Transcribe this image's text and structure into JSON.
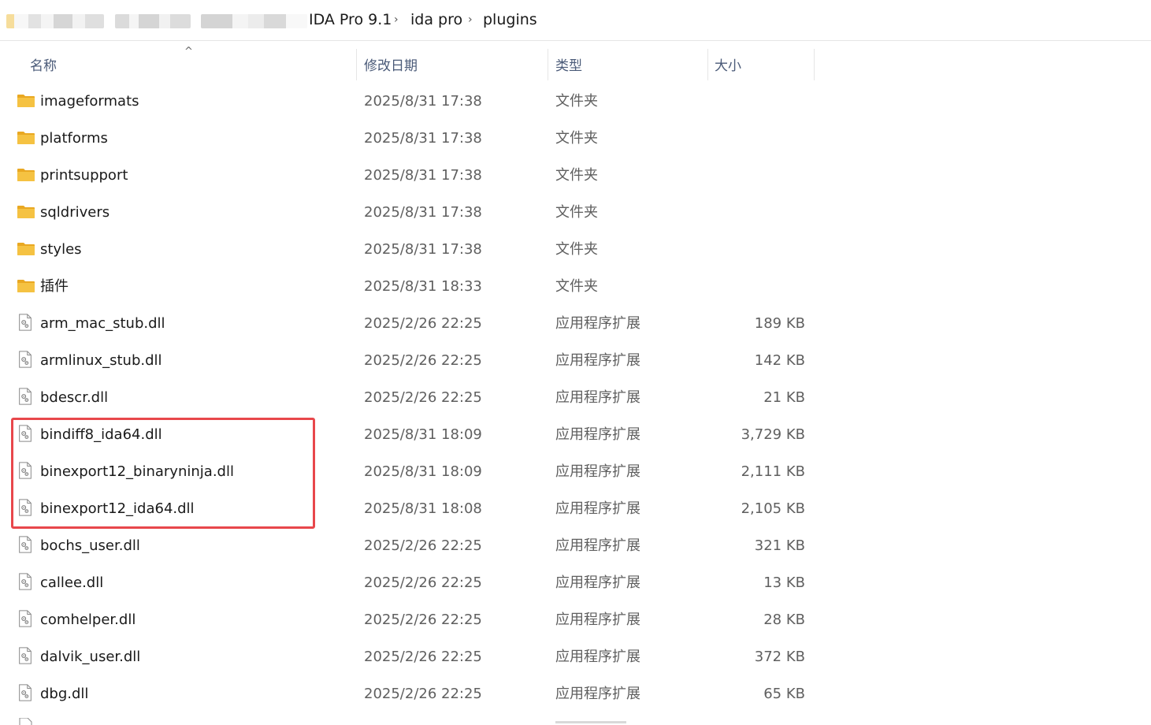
{
  "breadcrumb": {
    "items": [
      "IDA Pro 9.1",
      "ida pro",
      "plugins"
    ],
    "separator": "›"
  },
  "columns": {
    "name": "名称",
    "date": "修改日期",
    "type": "类型",
    "size": "大小",
    "sort_indicator": "^"
  },
  "files": [
    {
      "name": "imageformats",
      "date": "2025/8/31 17:38",
      "type": "文件夹",
      "size": "",
      "icon": "folder-icon"
    },
    {
      "name": "platforms",
      "date": "2025/8/31 17:38",
      "type": "文件夹",
      "size": "",
      "icon": "folder-icon"
    },
    {
      "name": "printsupport",
      "date": "2025/8/31 17:38",
      "type": "文件夹",
      "size": "",
      "icon": "folder-icon"
    },
    {
      "name": "sqldrivers",
      "date": "2025/8/31 17:38",
      "type": "文件夹",
      "size": "",
      "icon": "folder-icon"
    },
    {
      "name": "styles",
      "date": "2025/8/31 17:38",
      "type": "文件夹",
      "size": "",
      "icon": "folder-icon"
    },
    {
      "name": "插件",
      "date": "2025/8/31 18:33",
      "type": "文件夹",
      "size": "",
      "icon": "folder-icon"
    },
    {
      "name": "arm_mac_stub.dll",
      "date": "2025/2/26 22:25",
      "type": "应用程序扩展",
      "size": "189 KB",
      "icon": "dll-file-icon"
    },
    {
      "name": "armlinux_stub.dll",
      "date": "2025/2/26 22:25",
      "type": "应用程序扩展",
      "size": "142 KB",
      "icon": "dll-file-icon"
    },
    {
      "name": "bdescr.dll",
      "date": "2025/2/26 22:25",
      "type": "应用程序扩展",
      "size": "21 KB",
      "icon": "dll-file-icon"
    },
    {
      "name": "bindiff8_ida64.dll",
      "date": "2025/8/31 18:09",
      "type": "应用程序扩展",
      "size": "3,729 KB",
      "icon": "dll-file-icon"
    },
    {
      "name": "binexport12_binaryninja.dll",
      "date": "2025/8/31 18:09",
      "type": "应用程序扩展",
      "size": "2,111 KB",
      "icon": "dll-file-icon"
    },
    {
      "name": "binexport12_ida64.dll",
      "date": "2025/8/31 18:08",
      "type": "应用程序扩展",
      "size": "2,105 KB",
      "icon": "dll-file-icon"
    },
    {
      "name": "bochs_user.dll",
      "date": "2025/2/26 22:25",
      "type": "应用程序扩展",
      "size": "321 KB",
      "icon": "dll-file-icon"
    },
    {
      "name": "callee.dll",
      "date": "2025/2/26 22:25",
      "type": "应用程序扩展",
      "size": "13 KB",
      "icon": "dll-file-icon"
    },
    {
      "name": "comhelper.dll",
      "date": "2025/2/26 22:25",
      "type": "应用程序扩展",
      "size": "28 KB",
      "icon": "dll-file-icon"
    },
    {
      "name": "dalvik_user.dll",
      "date": "2025/2/26 22:25",
      "type": "应用程序扩展",
      "size": "372 KB",
      "icon": "dll-file-icon"
    },
    {
      "name": "dbg.dll",
      "date": "2025/2/26 22:25",
      "type": "应用程序扩展",
      "size": "65 KB",
      "icon": "dll-file-icon"
    }
  ],
  "colors": {
    "highlight_border": "#e8474b",
    "folder_yellow": "#f5c242",
    "header_text": "#4a5a78"
  }
}
